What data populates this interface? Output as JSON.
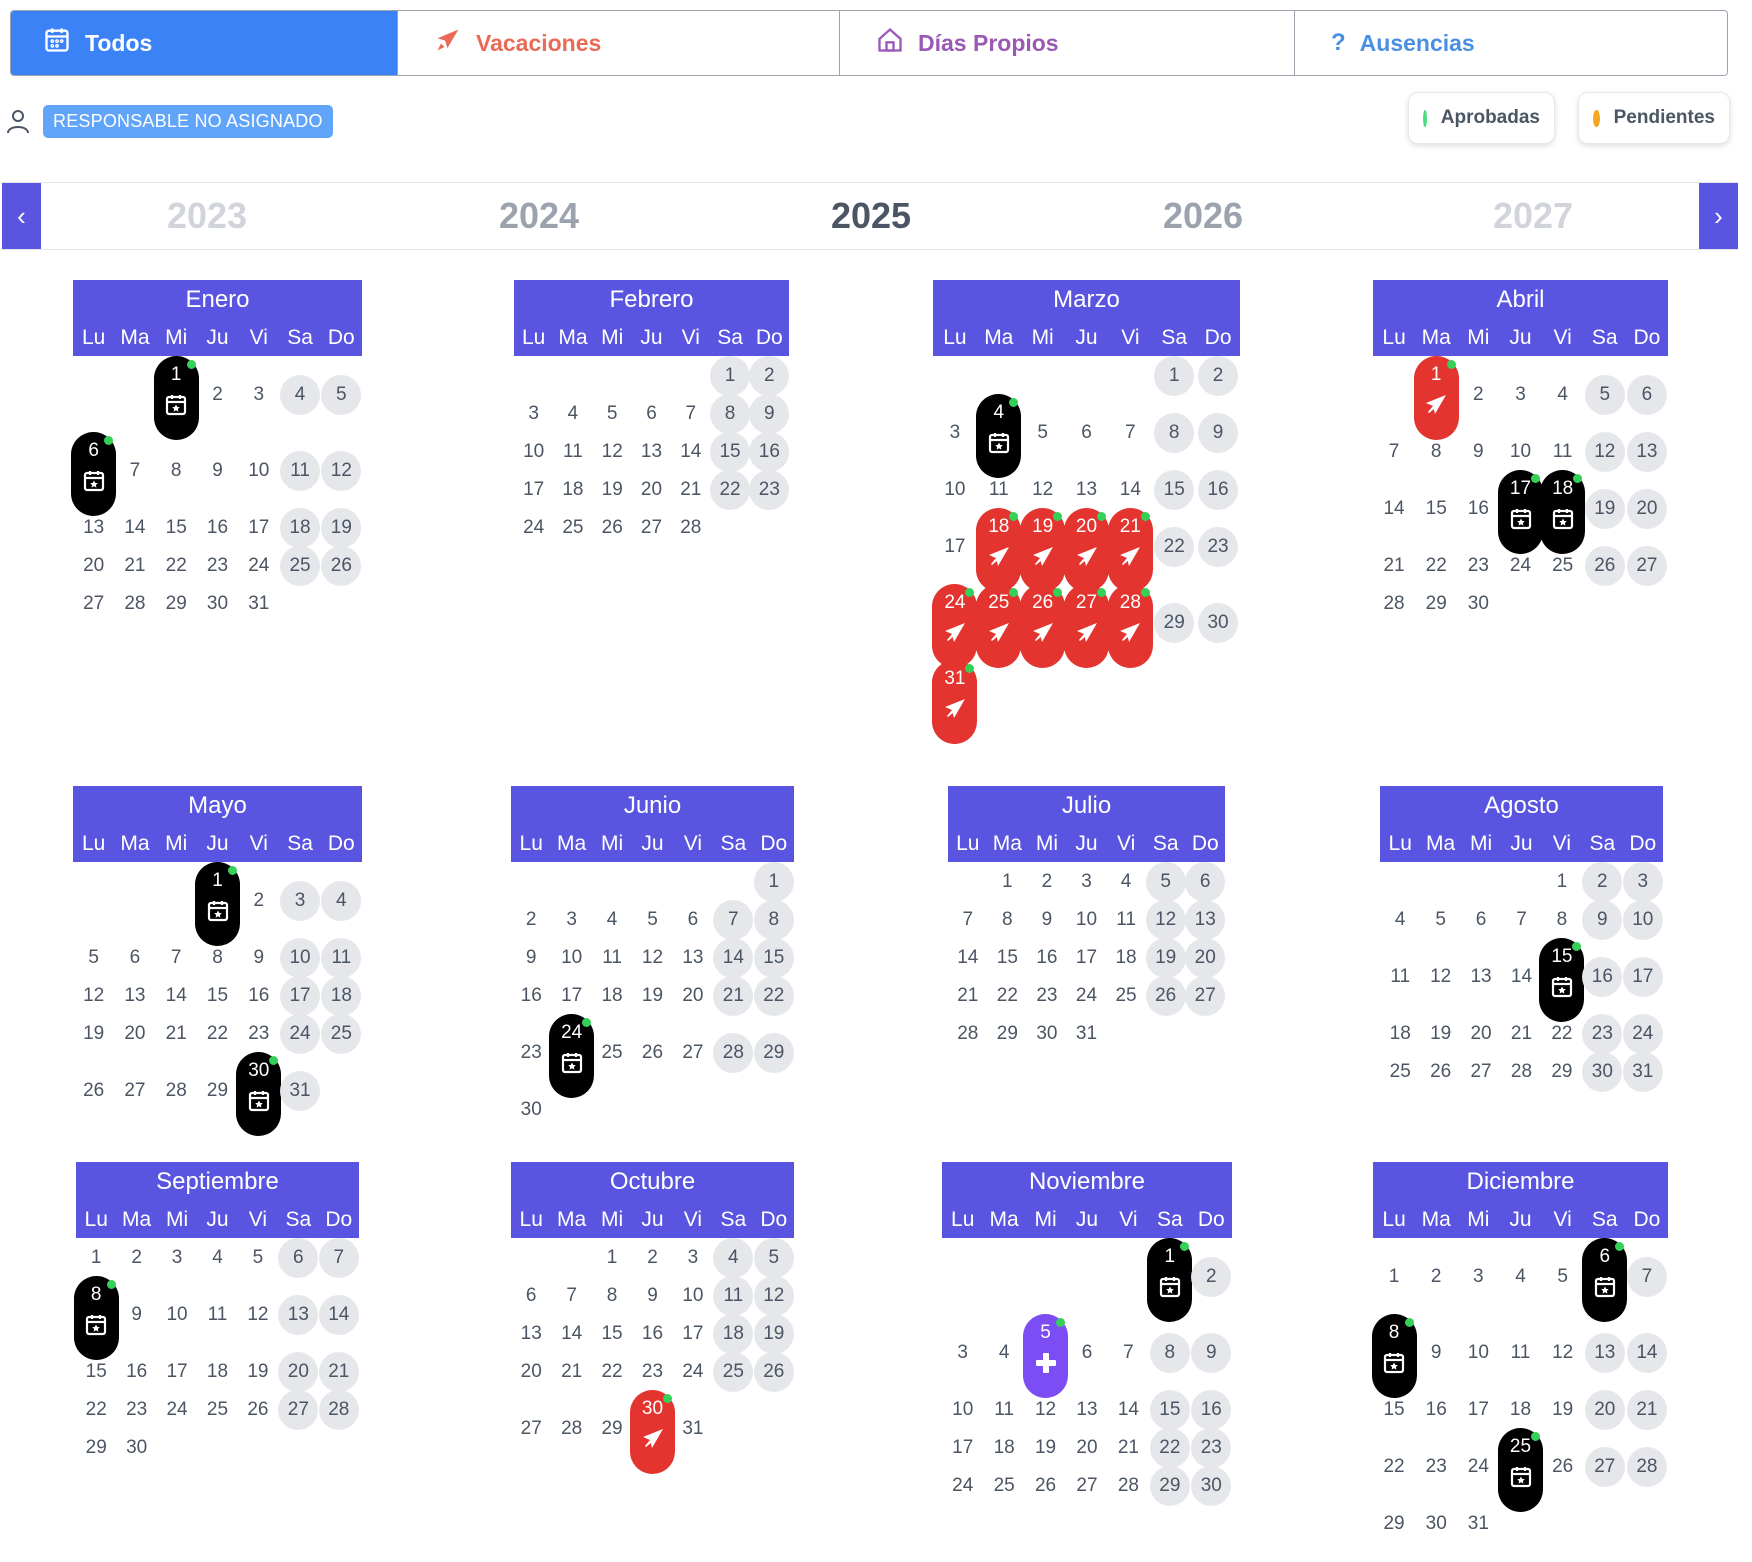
{
  "tabs": [
    {
      "label": "Todos",
      "icon": "calendar-icon",
      "active": true
    },
    {
      "label": "Vacaciones",
      "icon": "plane-icon"
    },
    {
      "label": "Días Propios",
      "icon": "home-icon"
    },
    {
      "label": "Ausencias",
      "icon": "question-icon"
    }
  ],
  "responsable": {
    "label": "RESPONSABLE NO ASIGNADO",
    "icon": "user-icon"
  },
  "status": [
    {
      "label": "Aprobadas",
      "color": "#4ade80"
    },
    {
      "label": "Pendientes",
      "color": "#f5a623"
    }
  ],
  "years": [
    "2023",
    "2024",
    "2025",
    "2026",
    "2027"
  ],
  "current_year": "2025",
  "weekday_labels": [
    "Lu",
    "Ma",
    "Mi",
    "Ju",
    "Vi",
    "Sa",
    "Do"
  ],
  "colors": {
    "accent": "#5a55e0",
    "active_tab": "#3b82f6",
    "vacation": "#e3342f",
    "event": "#000000",
    "own_day": "#7c4df5",
    "approved_dot": "#34d058"
  },
  "months": [
    {
      "name": "Enero",
      "days": 31,
      "first_weekday": 2,
      "events": [
        {
          "day": 1,
          "type": "event"
        },
        {
          "day": 6,
          "type": "event"
        }
      ]
    },
    {
      "name": "Febrero",
      "days": 28,
      "first_weekday": 5,
      "events": []
    },
    {
      "name": "Marzo",
      "days": 31,
      "first_weekday": 5,
      "events": [
        {
          "day": 4,
          "type": "event"
        },
        {
          "day": 18,
          "type": "vacation"
        },
        {
          "day": 19,
          "type": "vacation"
        },
        {
          "day": 20,
          "type": "vacation"
        },
        {
          "day": 21,
          "type": "vacation"
        },
        {
          "day": 24,
          "type": "vacation"
        },
        {
          "day": 25,
          "type": "vacation"
        },
        {
          "day": 26,
          "type": "vacation"
        },
        {
          "day": 27,
          "type": "vacation"
        },
        {
          "day": 28,
          "type": "vacation"
        },
        {
          "day": 31,
          "type": "vacation"
        }
      ]
    },
    {
      "name": "Abril",
      "days": 30,
      "first_weekday": 1,
      "events": [
        {
          "day": 1,
          "type": "vacation"
        },
        {
          "day": 17,
          "type": "event"
        },
        {
          "day": 18,
          "type": "event"
        }
      ]
    },
    {
      "name": "Mayo",
      "days": 31,
      "first_weekday": 3,
      "events": [
        {
          "day": 1,
          "type": "event"
        },
        {
          "day": 30,
          "type": "event"
        }
      ]
    },
    {
      "name": "Junio",
      "days": 30,
      "first_weekday": 6,
      "events": [
        {
          "day": 24,
          "type": "event"
        }
      ]
    },
    {
      "name": "Julio",
      "days": 31,
      "first_weekday": 1,
      "events": []
    },
    {
      "name": "Agosto",
      "days": 31,
      "first_weekday": 4,
      "events": [
        {
          "day": 15,
          "type": "event"
        }
      ]
    },
    {
      "name": "Septiembre",
      "days": 30,
      "first_weekday": 0,
      "events": [
        {
          "day": 8,
          "type": "event"
        }
      ]
    },
    {
      "name": "Octubre",
      "days": 31,
      "first_weekday": 2,
      "events": [
        {
          "day": 30,
          "type": "vacation"
        }
      ]
    },
    {
      "name": "Noviembre",
      "days": 30,
      "first_weekday": 5,
      "events": [
        {
          "day": 1,
          "type": "event"
        },
        {
          "day": 5,
          "type": "own"
        }
      ]
    },
    {
      "name": "Diciembre",
      "days": 31,
      "first_weekday": 0,
      "events": [
        {
          "day": 6,
          "type": "event"
        },
        {
          "day": 8,
          "type": "event"
        },
        {
          "day": 25,
          "type": "event"
        }
      ]
    }
  ]
}
